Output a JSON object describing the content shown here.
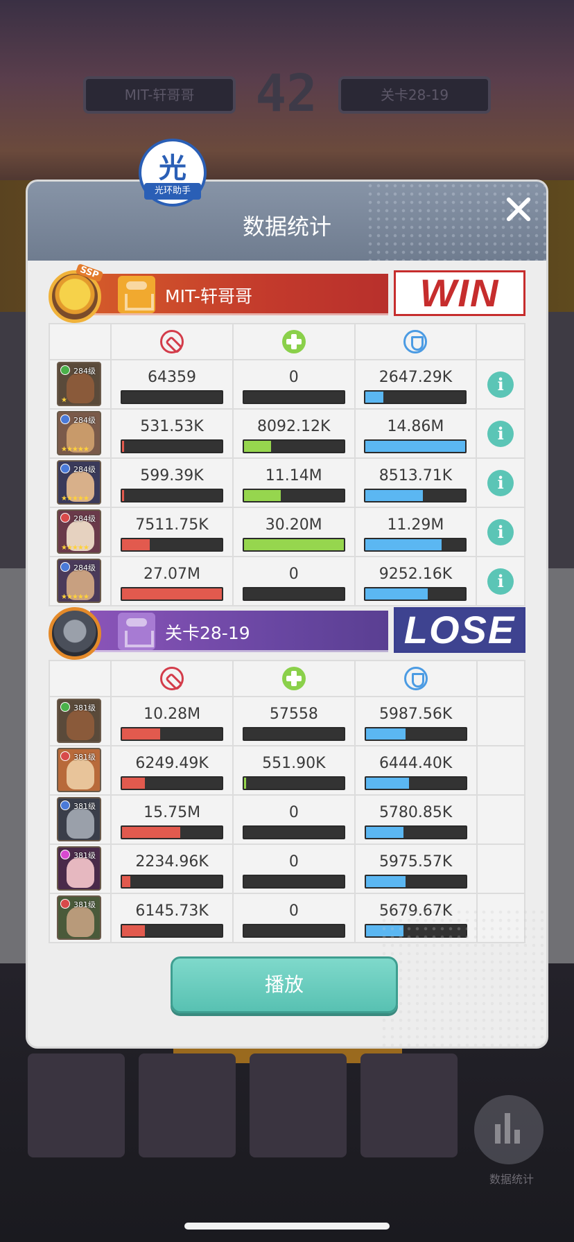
{
  "dialog": {
    "title": "数据统计",
    "play_label": "播放"
  },
  "watermark": {
    "char": "光",
    "sub": "光环助手"
  },
  "background": {
    "round": "42",
    "left_pill": "MIT-轩哥哥",
    "right_pill": "关卡28-19",
    "stats_btn": "数据统计"
  },
  "win_team": {
    "name": "MIT-轩哥哥",
    "result": "WIN",
    "badge": "SSP",
    "heroes": [
      {
        "level": "284级",
        "element_color": "#4ab04a",
        "face": "#8a5a3a",
        "bg": "#5a4a3a",
        "stars": "★",
        "damage": "64359",
        "heal": "0",
        "shield": "2647.29K",
        "damage_ratio": 0.0,
        "heal_ratio": 0.0,
        "shield_ratio": 0.18
      },
      {
        "level": "284级",
        "element_color": "#4a7ad8",
        "face": "#c89a6a",
        "bg": "#7a5a4a",
        "stars": "★★★★★",
        "damage": "531.53K",
        "heal": "8092.12K",
        "shield": "14.86M",
        "damage_ratio": 0.02,
        "heal_ratio": 0.27,
        "shield_ratio": 1.0
      },
      {
        "level": "284级",
        "element_color": "#4a7ad8",
        "face": "#d8b08a",
        "bg": "#3a3a5a",
        "stars": "★★★★★",
        "damage": "599.39K",
        "heal": "11.14M",
        "shield": "8513.71K",
        "damage_ratio": 0.02,
        "heal_ratio": 0.37,
        "shield_ratio": 0.57
      },
      {
        "level": "284级",
        "element_color": "#d84a4a",
        "face": "#e6d2c0",
        "bg": "#6a3a4a",
        "stars": "★★★★★",
        "damage": "7511.75K",
        "heal": "30.20M",
        "shield": "11.29M",
        "damage_ratio": 0.28,
        "heal_ratio": 1.0,
        "shield_ratio": 0.76
      },
      {
        "level": "284级",
        "element_color": "#4a7ad8",
        "face": "#c8a080",
        "bg": "#4a3a5a",
        "stars": "★★★★★",
        "damage": "27.07M",
        "heal": "0",
        "shield": "9252.16K",
        "damage_ratio": 1.0,
        "heal_ratio": 0.0,
        "shield_ratio": 0.62
      }
    ]
  },
  "lose_team": {
    "name": "关卡28-19",
    "result": "LOSE",
    "heroes": [
      {
        "level": "381级",
        "element_color": "#4ab04a",
        "face": "#8a5a3a",
        "bg": "#5a4a3a",
        "damage": "10.28M",
        "heal": "57558",
        "shield": "5987.56K",
        "damage_ratio": 0.38,
        "heal_ratio": 0.0,
        "shield_ratio": 0.4
      },
      {
        "level": "381级",
        "element_color": "#d84a4a",
        "face": "#e8c49a",
        "bg": "#b86a3a",
        "damage": "6249.49K",
        "heal": "551.90K",
        "shield": "6444.40K",
        "damage_ratio": 0.23,
        "heal_ratio": 0.02,
        "shield_ratio": 0.43
      },
      {
        "level": "381级",
        "element_color": "#4a7ad8",
        "face": "#9aa0aa",
        "bg": "#3a3e4a",
        "damage": "15.75M",
        "heal": "0",
        "shield": "5780.85K",
        "damage_ratio": 0.58,
        "heal_ratio": 0.0,
        "shield_ratio": 0.38
      },
      {
        "level": "381级",
        "element_color": "#d84ad0",
        "face": "#e6b8c0",
        "bg": "#4a2a4a",
        "damage": "2234.96K",
        "heal": "0",
        "shield": "5975.57K",
        "damage_ratio": 0.08,
        "heal_ratio": 0.0,
        "shield_ratio": 0.4
      },
      {
        "level": "381级",
        "element_color": "#d84a4a",
        "face": "#b89a7a",
        "bg": "#4a5a3a",
        "damage": "6145.73K",
        "heal": "0",
        "shield": "5679.67K",
        "damage_ratio": 0.23,
        "heal_ratio": 0.0,
        "shield_ratio": 0.38
      }
    ]
  }
}
